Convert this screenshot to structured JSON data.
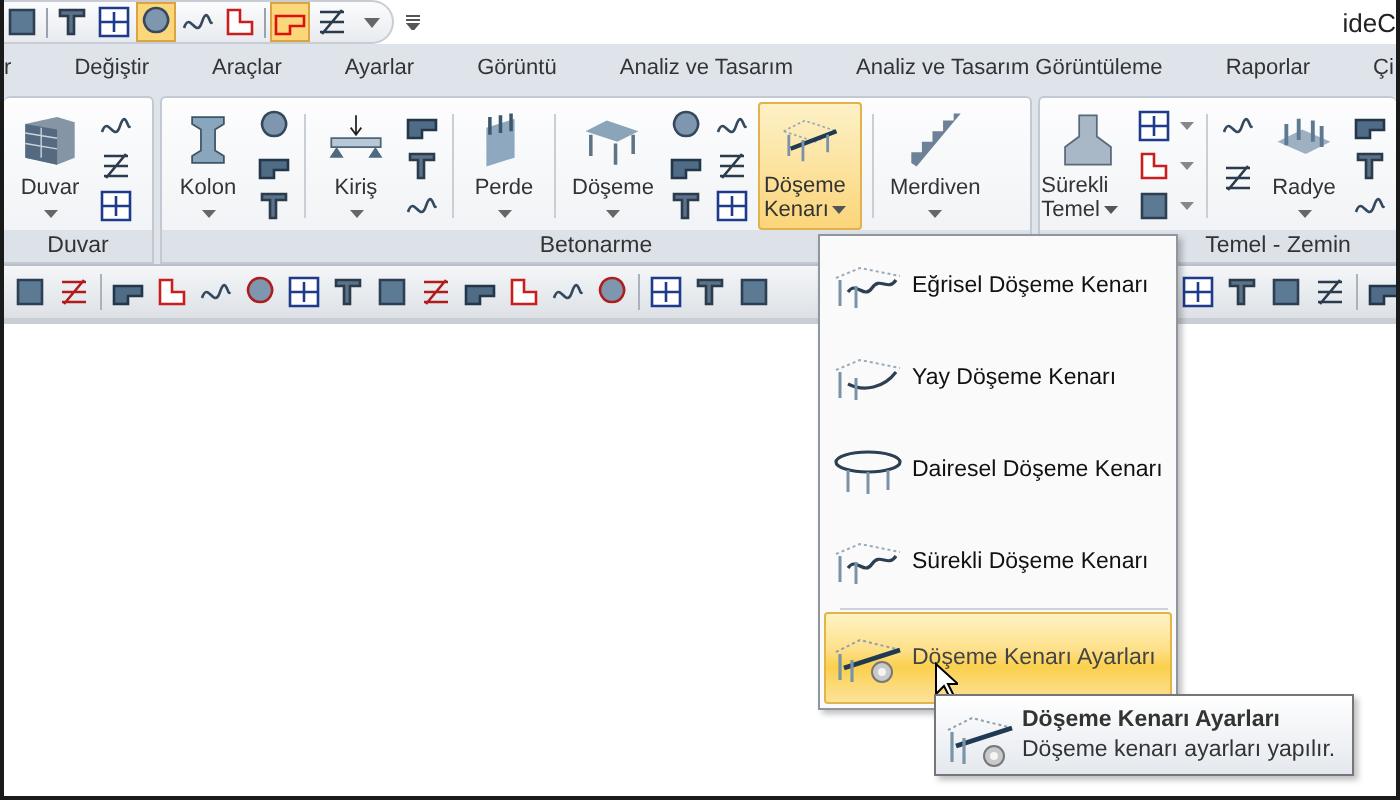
{
  "window": {
    "title": "ideC"
  },
  "tabs": [
    {
      "label": "r",
      "selected": false
    },
    {
      "label": "Değiştir",
      "selected": false
    },
    {
      "label": "Araçlar",
      "selected": false
    },
    {
      "label": "Ayarlar",
      "selected": false
    },
    {
      "label": "Görüntü",
      "selected": false
    },
    {
      "label": "Analiz ve Tasarım",
      "selected": false
    },
    {
      "label": "Analiz ve Tasarım Görüntüleme",
      "selected": false
    },
    {
      "label": "Raporlar",
      "selected": false
    },
    {
      "label": "Çi",
      "selected": false
    }
  ],
  "groups": [
    {
      "label": "Duvar",
      "items": [
        {
          "kind": "large",
          "label": "Duvar",
          "selected": false
        },
        {
          "kind": "icons"
        }
      ]
    },
    {
      "label": "Betonarme",
      "items": [
        {
          "kind": "large",
          "label": "Kolon",
          "selected": false
        },
        {
          "kind": "icons"
        },
        {
          "kind": "separator"
        },
        {
          "kind": "large",
          "label": "Kiriş",
          "selected": false
        },
        {
          "kind": "icons"
        },
        {
          "kind": "separator"
        },
        {
          "kind": "large",
          "label": "Perde",
          "selected": false
        },
        {
          "kind": "separator"
        },
        {
          "kind": "large",
          "label": "Döşeme",
          "selected": false
        },
        {
          "kind": "icons"
        },
        {
          "kind": "icons"
        },
        {
          "kind": "large-wrap",
          "label": "Döşeme Kenarı",
          "selected": true
        },
        {
          "kind": "separator"
        },
        {
          "kind": "large",
          "label": "Merdiven",
          "selected": false
        }
      ]
    },
    {
      "label": "Temel - Zemin",
      "items": [
        {
          "kind": "large-wrap",
          "label": "Sürekli Temel",
          "selected": false
        },
        {
          "kind": "icons-menu"
        },
        {
          "kind": "separator"
        },
        {
          "kind": "icons-two"
        },
        {
          "kind": "large",
          "label": "Radye",
          "selected": false
        },
        {
          "kind": "icons"
        }
      ]
    }
  ],
  "dropdown": {
    "items": [
      {
        "kind": "item",
        "label": "Eğrisel Döşeme Kenarı",
        "selected": false
      },
      {
        "kind": "item",
        "label": "Yay Döşeme Kenarı",
        "selected": false
      },
      {
        "kind": "item",
        "label": "Dairesel Döşeme Kenarı",
        "selected": false
      },
      {
        "kind": "item",
        "label": "Sürekli Döşeme Kenarı",
        "selected": false
      },
      {
        "kind": "settings",
        "label": "Döşeme Kenarı Ayarları",
        "selected": true
      }
    ]
  },
  "tooltip": {
    "title": "Döşeme Kenarı Ayarları",
    "text": "Döşeme kenarı ayarları yapılır."
  }
}
